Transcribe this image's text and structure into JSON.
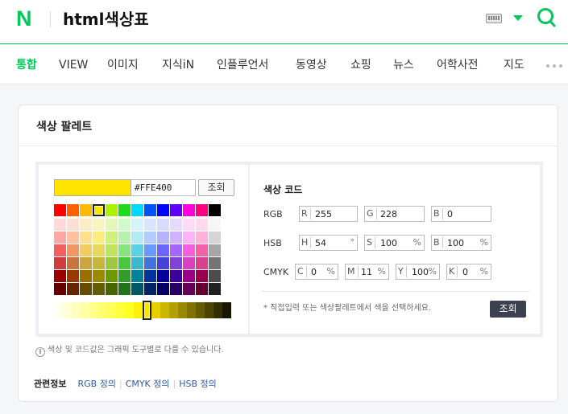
{
  "header": {
    "logo": "N",
    "query": "html색상표"
  },
  "tabs": [
    {
      "label": "통합",
      "active": true
    },
    {
      "label": "VIEW"
    },
    {
      "label": "이미지"
    },
    {
      "label": "지식iN"
    },
    {
      "label": "인플루언서"
    },
    {
      "label": "동영상"
    },
    {
      "label": "쇼핑"
    },
    {
      "label": "뉴스"
    },
    {
      "label": "어학사전"
    },
    {
      "label": "지도"
    }
  ],
  "card": {
    "title": "색상 팔레트"
  },
  "picker": {
    "current_color": "#FFE400",
    "hex_value": "#FFE400",
    "lookup_button": "조회",
    "selected_palette_index": 3,
    "palette": [
      [
        "#FF0000",
        "#FF5E00",
        "#FFBB00",
        "#FFE400",
        "#ABF200",
        "#1DDB16",
        "#00D8FF",
        "#0054FF",
        "#0100FF",
        "#5F00FF",
        "#FF00DD",
        "#FF007F",
        "#000000"
      ],
      [
        "#FFD8D8",
        "#FAE0D4",
        "#FAECC5",
        "#FAF4C0",
        "#E4F7BA",
        "#CEFBC9",
        "#D4F4FA",
        "#D9E5FF",
        "#DAD9FF",
        "#E8D9FF",
        "#FFD9FA",
        "#FFD9EC",
        "#F6F6F6"
      ],
      [
        "#FFA7A7",
        "#FFC19E",
        "#FFE08C",
        "#FAED7D",
        "#CEF279",
        "#B7F0B1",
        "#B2EBF4",
        "#B2CCFF",
        "#B5B2FF",
        "#D1B2FF",
        "#FFB2F5",
        "#FFB2D9",
        "#D5D5D5"
      ],
      [
        "#F15F5F",
        "#F29661",
        "#F2CB61",
        "#E5D85C",
        "#BCE55C",
        "#86E57F",
        "#5CD1E5",
        "#6799FF",
        "#6B66FF",
        "#A566FF",
        "#F361DC",
        "#F361A6",
        "#A6A6A6"
      ],
      [
        "#CC3D3D",
        "#CC723D",
        "#CCA63D",
        "#C4B73B",
        "#9FC93C",
        "#47C83E",
        "#3DB7CC",
        "#4374D9",
        "#4641D9",
        "#8041D9",
        "#D941C5",
        "#D9418C",
        "#747474"
      ],
      [
        "#980000",
        "#993800",
        "#997000",
        "#998A00",
        "#6B9900",
        "#2F9D27",
        "#008299",
        "#003399",
        "#050099",
        "#3F0099",
        "#990085",
        "#99004C",
        "#4C4C4C"
      ],
      [
        "#670000",
        "#662500",
        "#664B00",
        "#665C00",
        "#476600",
        "#22741C",
        "#005766",
        "#002266",
        "#030066",
        "#2A0066",
        "#660058",
        "#660033",
        "#212121"
      ]
    ],
    "gradient_selected_index": 10,
    "gradient": [
      "#FFFFEF",
      "#FFFFD6",
      "#FFFFBD",
      "#FFFFA4",
      "#FFFF8A",
      "#FFFF70",
      "#FFFF57",
      "#FFFF3D",
      "#FFFF24",
      "#FFF20A",
      "#FFE400",
      "#E6CE00",
      "#CCB700",
      "#B3A000",
      "#998900",
      "#807200",
      "#665B00",
      "#4D4400",
      "#332E00",
      "#1A1700"
    ]
  },
  "codes": {
    "title": "색상 코드",
    "rgb": {
      "label": "RGB",
      "fields": [
        {
          "prefix": "R",
          "value": "255"
        },
        {
          "prefix": "G",
          "value": "228"
        },
        {
          "prefix": "B",
          "value": "0"
        }
      ]
    },
    "hsb": {
      "label": "HSB",
      "fields": [
        {
          "prefix": "H",
          "value": "54",
          "unit": "°"
        },
        {
          "prefix": "S",
          "value": "100",
          "unit": "%"
        },
        {
          "prefix": "B",
          "value": "100",
          "unit": "%"
        }
      ]
    },
    "cmyk": {
      "label": "CMYK",
      "fields": [
        {
          "prefix": "C",
          "value": "0",
          "unit": "%"
        },
        {
          "prefix": "M",
          "value": "11",
          "unit": "%"
        },
        {
          "prefix": "Y",
          "value": "100",
          "unit": "%"
        },
        {
          "prefix": "K",
          "value": "0",
          "unit": "%"
        }
      ]
    },
    "note": "* 직접입력 또는 색상팔레트에서 색을 선택하세요.",
    "button": "조회"
  },
  "info": {
    "icon": "info-icon",
    "text": "색상 및 코드값은 그래픽 도구별로 다를 수 있습니다."
  },
  "related": {
    "label": "관련정보",
    "links": [
      "RGB 정의",
      "CMYK 정의",
      "HSB 정의"
    ]
  },
  "colors": {
    "brand": "#03c75a",
    "dark_button": "#3c4150",
    "link": "#2e5aa5"
  }
}
